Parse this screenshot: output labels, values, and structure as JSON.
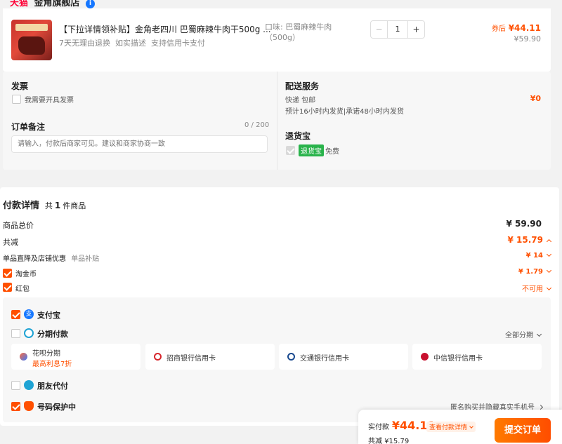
{
  "store": {
    "brand": "天猫",
    "name": "金角旗舰店",
    "badge": "i"
  },
  "product": {
    "title": "【下拉详情领补贴】金角老四川 巴蜀麻辣牛肉干500g ...",
    "tags": "7天无理由退换  如实描述  支持信用卡支付",
    "spec_label": "口味:",
    "spec_value": "巴蜀麻辣牛肉",
    "spec_size": "（500g）",
    "quantity": "1",
    "minus": "−",
    "plus": "+",
    "coupon_price_label": "券后",
    "coupon_price": "¥44.11",
    "original_price": "¥59.90"
  },
  "invoice": {
    "title": "发票",
    "option": "我需要开具发票"
  },
  "remark": {
    "title": "订单备注",
    "count": "0 / 200",
    "placeholder": "请输入，付款后商家可见。建议和商家协商一致"
  },
  "delivery": {
    "title": "配送服务",
    "method": "快递 包邮",
    "price": "¥0",
    "eta": "预计16小时内发货|承诺48小时内发货"
  },
  "return_insurance": {
    "title": "退货宝",
    "tag": "退货宝",
    "text": "免费"
  },
  "payment": {
    "title": "付款详情",
    "count_prefix": "共",
    "count": "1",
    "count_suffix": "件商品",
    "total_label": "商品总价",
    "total": "¥ 59.90",
    "discount_label": "共减",
    "discount": "¥ 15.79",
    "store_discount_label": "单品直降及店铺优惠",
    "store_discount_sub": "单品补贴",
    "store_discount": "¥ 14",
    "coin_label": "淘金币",
    "coin": "¥ 1.79",
    "redpacket_label": "红包",
    "redpacket": "不可用"
  },
  "methods": {
    "alipay": "支付宝",
    "installment": "分期付款",
    "installment_all": "全部分期",
    "huabei": "花呗分期",
    "huabei_sub": "最高利息7折",
    "cmb": "招商银行信用卡",
    "bocom": "交通银行信用卡",
    "citic": "中信银行信用卡",
    "friend": "朋友代付",
    "protect": "号码保护中",
    "protect_sub": "匿名购买并隐藏真实手机号"
  },
  "footer": {
    "pay_label": "实付款",
    "pay_amount": "¥44.11",
    "detail_link": "查看付款详情",
    "saved_label": "共减",
    "saved": "¥15.79",
    "submit": "提交订单"
  },
  "colors": {
    "accent": "#ff5000",
    "alipay": "#1677ff",
    "success": "#29b34b"
  }
}
